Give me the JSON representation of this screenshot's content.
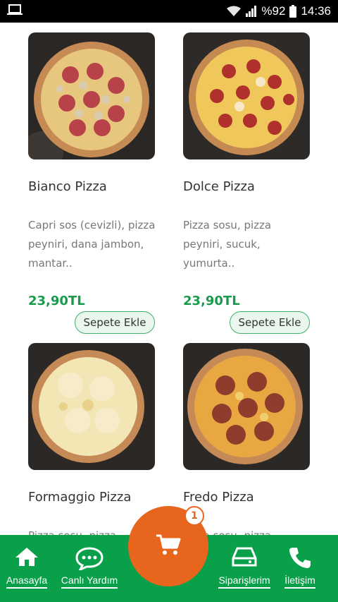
{
  "status_bar": {
    "battery": "%92",
    "time": "14:36"
  },
  "products": [
    {
      "name": "Bianco Pizza",
      "description": "Capri sos (cevizli), pizza peyniri, dana jambon, mantar..",
      "price": "23,90TL",
      "button": "Sepete Ekle"
    },
    {
      "name": "Dolce Pizza",
      "description": "Pizza sosu, pizza peyniri, sucuk, yumurta..",
      "price": "23,90TL",
      "button": "Sepete Ekle"
    },
    {
      "name": "Formaggio Pizza",
      "description": "Pizza sosu, pizza",
      "price": "",
      "button": ""
    },
    {
      "name": "Fredo Pizza",
      "description": "Pizza sosu, pizza",
      "price": "",
      "button": ""
    }
  ],
  "cart": {
    "count": "1"
  },
  "bottom_nav": {
    "home": "Anasayfa",
    "live_help": "Canlı Yardım",
    "orders": "Siparişlerim",
    "contact": "İletişim"
  },
  "colors": {
    "brand_green": "#0aa04a",
    "price_green": "#1a9a4c",
    "cart_orange": "#e8651d"
  }
}
